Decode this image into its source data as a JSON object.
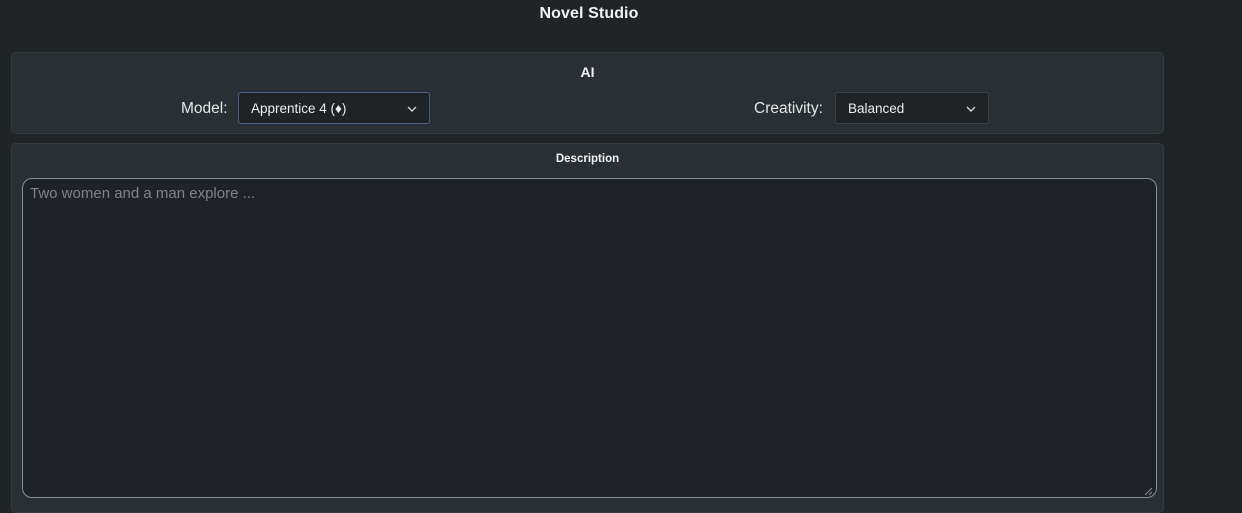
{
  "app": {
    "title": "Novel Studio"
  },
  "ai_panel": {
    "title": "AI",
    "model": {
      "label": "Model:",
      "value": "Apprentice 4 (♦)"
    },
    "creativity": {
      "label": "Creativity:",
      "value": "Balanced"
    }
  },
  "description_panel": {
    "title": "Description",
    "input": {
      "value": "",
      "placeholder": "Two women and a man explore ..."
    }
  },
  "colors": {
    "background": "#202427",
    "panel": "#283034",
    "input_bg": "#1f2326",
    "focus_border": "#4d5a8a",
    "text": "#e8eaec",
    "placeholder": "#7f8489"
  },
  "icons": [
    "chevron-down-icon",
    "resize-handle-icon"
  ]
}
